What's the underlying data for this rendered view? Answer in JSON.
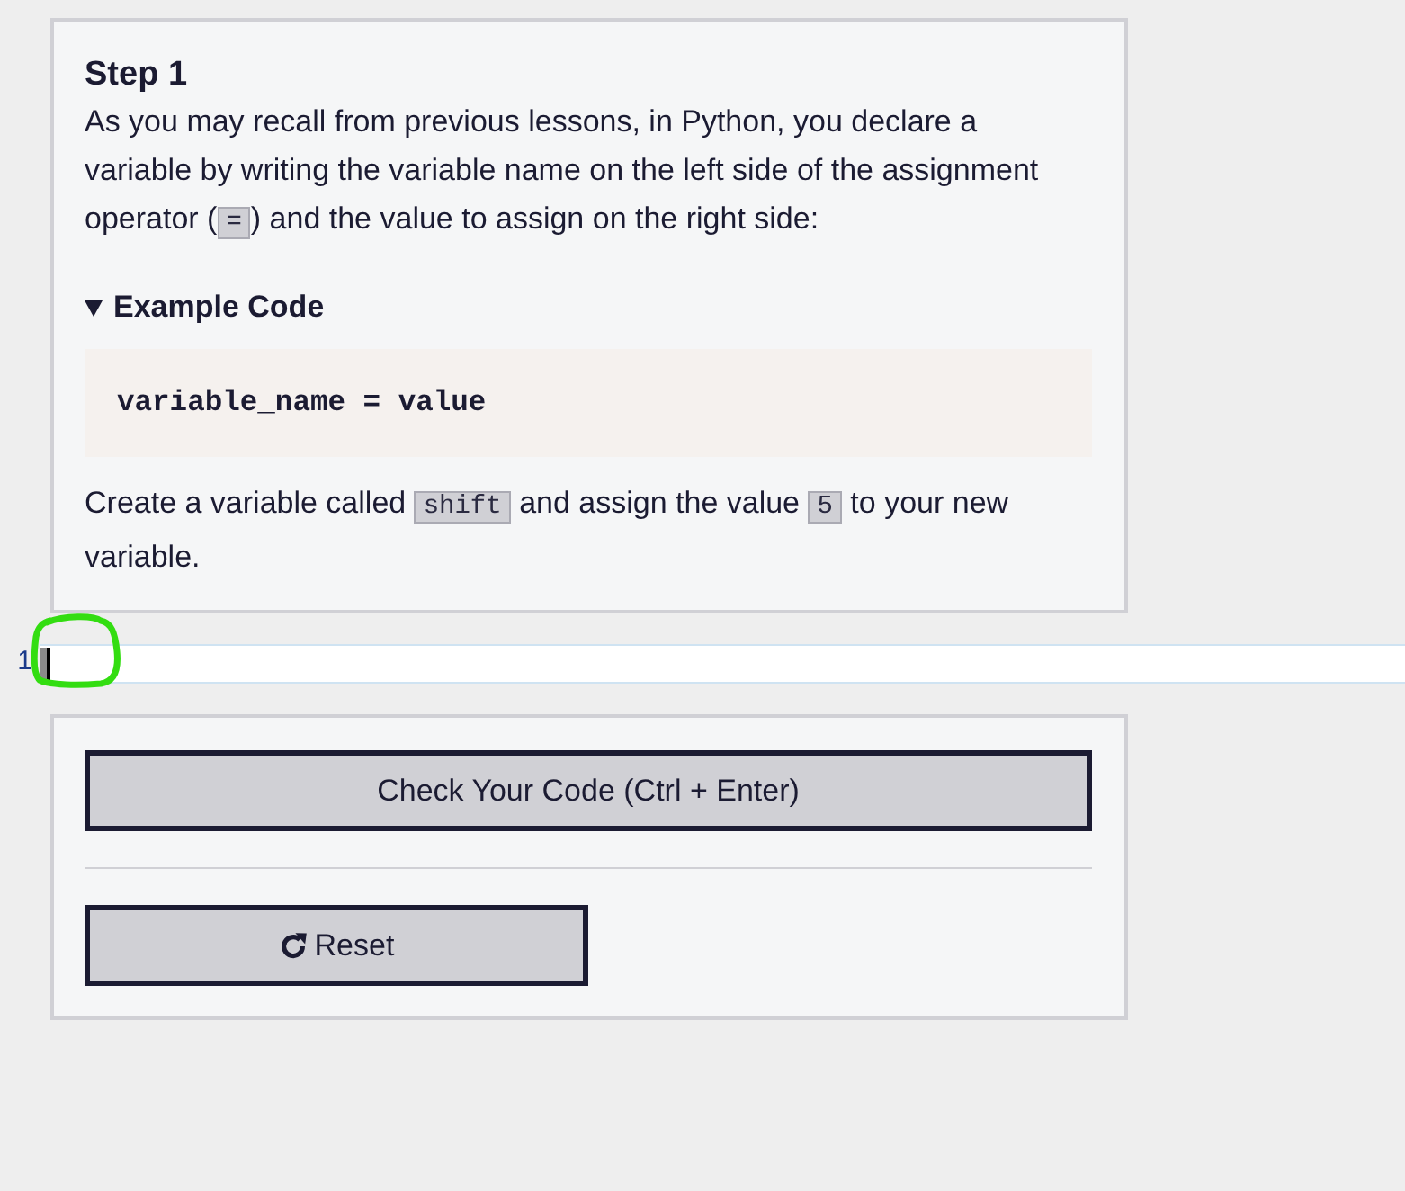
{
  "step": {
    "title": "Step 1",
    "intro": [
      {
        "kind": "text",
        "text": "As you may recall from previous lessons, in Python, you declare a variable by writing the variable name on the left side of the assignment operator ("
      },
      {
        "kind": "code",
        "text": "="
      },
      {
        "kind": "text",
        "text": ") and the value to assign on the right side:"
      }
    ]
  },
  "example": {
    "summary": "Example Code",
    "expanded": true,
    "code": "variable_name = value"
  },
  "task": [
    {
      "kind": "text",
      "text": "Create a variable called "
    },
    {
      "kind": "code",
      "text": "shift"
    },
    {
      "kind": "text",
      "text": " and assign the value "
    },
    {
      "kind": "code",
      "text": "5"
    },
    {
      "kind": "text",
      "text": " to your new variable."
    }
  ],
  "editor": {
    "line_numbers": [
      "1"
    ],
    "focused": true
  },
  "actions": [
    {
      "kind": "submit",
      "label": "Check Your Code (Ctrl + Enter)"
    },
    {
      "kind": "reset",
      "label": "Reset"
    }
  ]
}
